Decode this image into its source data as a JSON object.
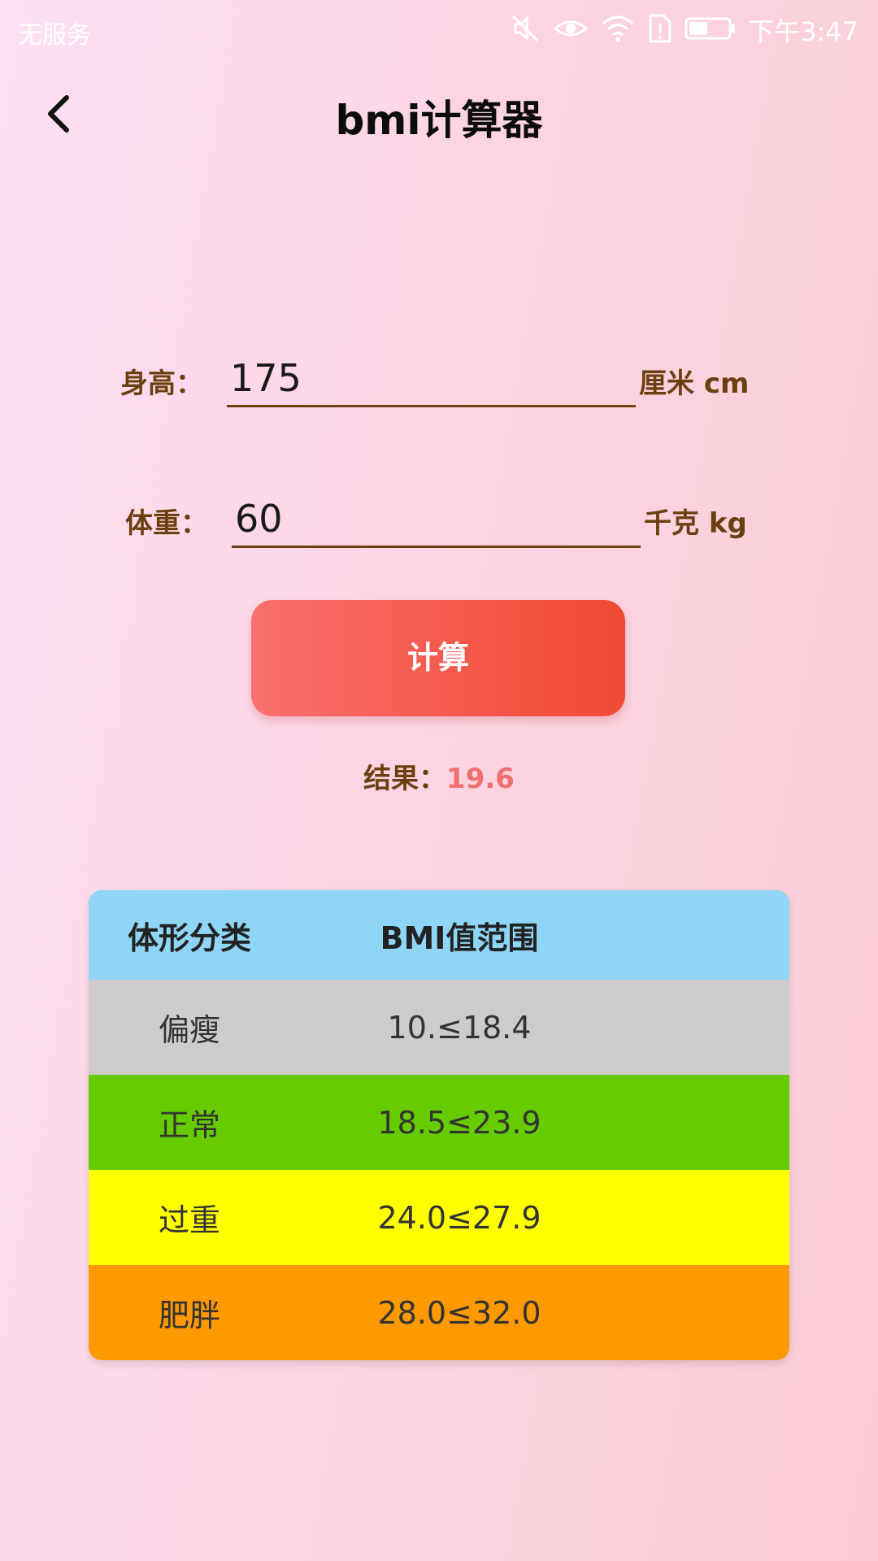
{
  "status_bar": {
    "carrier": "无服务",
    "time": "下午3:47",
    "icons": [
      "mute-icon",
      "eye-icon",
      "wifi-icon",
      "sim-icon",
      "battery-icon"
    ]
  },
  "header": {
    "title": "bmi计算器",
    "back_icon": "chevron-left-icon"
  },
  "form": {
    "height": {
      "label": "身高：",
      "value": "175",
      "unit": "厘米 cm"
    },
    "weight": {
      "label": "体重：",
      "value": "60",
      "unit": "千克 kg"
    },
    "calc_label": "计算"
  },
  "result": {
    "label": "结果：",
    "value": "19.6"
  },
  "table": {
    "headers": [
      "体形分类",
      "BMI值范围"
    ],
    "rows": [
      {
        "category": "偏瘦",
        "range": "10.≤18.4",
        "color": "#cccccc"
      },
      {
        "category": "正常",
        "range": "18.5≤23.9",
        "color": "#66cc00"
      },
      {
        "category": "过重",
        "range": "24.0≤27.9",
        "color": "#ffff00"
      },
      {
        "category": "肥胖",
        "range": "28.0≤32.0",
        "color": "#ff9900"
      }
    ],
    "header_color": "#8fd6f6"
  },
  "colors": {
    "label_brown": "#6b3f0f",
    "result_value": "#f06f6f",
    "button_start": "#f9706d",
    "button_end": "#f04a34"
  }
}
